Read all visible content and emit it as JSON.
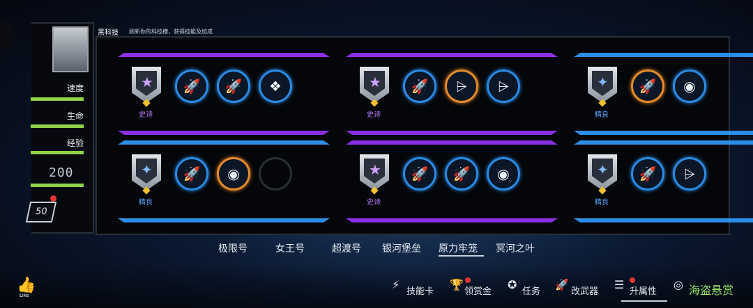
{
  "header": {
    "title": "黑科技",
    "desc": "刷新你的科技槽，获得技能及加成"
  },
  "stats": [
    {
      "label": "速度"
    },
    {
      "label": "生命"
    },
    {
      "label": "经验"
    }
  ],
  "stat_value": "200",
  "badge_num": "50",
  "cards": [
    {
      "rarity": "史诗",
      "kind": "epic",
      "color": "purple",
      "glyph": "★",
      "icons": [
        {
          "g": "🚀",
          "c": "blue",
          "name": "rocket-icon"
        },
        {
          "g": "🚀",
          "c": "blue",
          "name": "rocket-icon"
        },
        {
          "g": "❖",
          "c": "blue",
          "name": "cluster-missile-icon"
        }
      ]
    },
    {
      "rarity": "史诗",
      "kind": "epic",
      "color": "purple",
      "glyph": "★",
      "icons": [
        {
          "g": "🚀",
          "c": "blue",
          "name": "rocket-icon"
        },
        {
          "g": "⩥",
          "c": "orange",
          "name": "coil-icon"
        },
        {
          "g": "⩥",
          "c": "blue",
          "name": "coil-icon"
        }
      ]
    },
    {
      "rarity": "精良",
      "kind": "elite",
      "color": "blue",
      "glyph": "✦",
      "icons": [
        {
          "g": "🚀",
          "c": "orange",
          "name": "rocket-icon"
        },
        {
          "g": "◉",
          "c": "blue",
          "name": "shield-gear-icon"
        }
      ]
    },
    {
      "rarity": "精良",
      "kind": "elite",
      "color": "blue",
      "glyph": "✦",
      "icons": [
        {
          "g": "🚀",
          "c": "blue",
          "name": "rocket-icon"
        },
        {
          "g": "◉",
          "c": "orange",
          "name": "shield-gear-icon"
        },
        {
          "g": "",
          "c": "empty",
          "name": "empty-slot-icon"
        }
      ]
    },
    {
      "rarity": "史诗",
      "kind": "epic",
      "color": "purple",
      "glyph": "★",
      "icons": [
        {
          "g": "🚀",
          "c": "blue",
          "name": "rocket-icon"
        },
        {
          "g": "🚀",
          "c": "blue",
          "name": "rocket-icon"
        },
        {
          "g": "◉",
          "c": "blue",
          "name": "shield-gear-icon"
        }
      ]
    },
    {
      "rarity": "精良",
      "kind": "elite",
      "color": "blue",
      "glyph": "✦",
      "icons": [
        {
          "g": "🚀",
          "c": "blue",
          "name": "rocket-icon"
        },
        {
          "g": "⩥",
          "c": "blue",
          "name": "coil-icon"
        }
      ]
    }
  ],
  "tabs": [
    "极限号",
    "女王号",
    "超渡号",
    "银河堡垒",
    "原力牢笼",
    "冥河之叶"
  ],
  "active_tab": "原力牢笼",
  "nav": [
    {
      "label": "技能卡",
      "icon": "⚡",
      "dot": false
    },
    {
      "label": "领赏金",
      "icon": "🏆",
      "dot": true
    },
    {
      "label": "任务",
      "icon": "✪",
      "dot": false
    },
    {
      "label": "改武器",
      "icon": "🚀",
      "dot": false
    },
    {
      "label": "升属性",
      "icon": "☰",
      "dot": true
    },
    {
      "label": "海盗悬赏",
      "icon": "◎",
      "dot": false
    }
  ],
  "like": {
    "label": "Like"
  },
  "colors": {
    "purple": "#8a2fe6",
    "blue": "#2a8de6",
    "orange": "#e58a2c",
    "green_bar": "#8ed34a",
    "red_dot": "#e53535"
  }
}
